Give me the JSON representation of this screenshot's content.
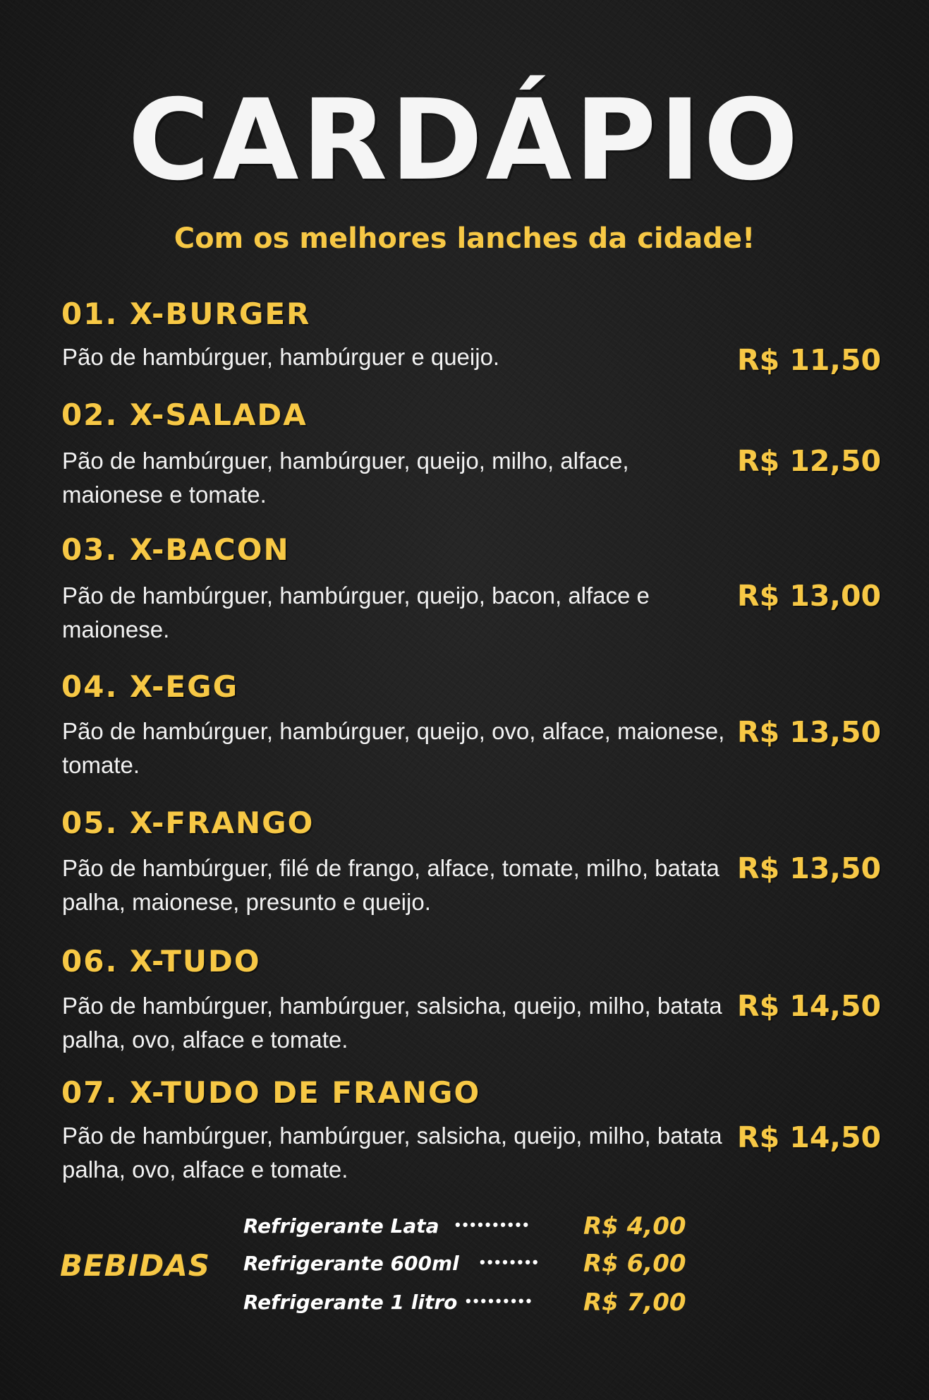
{
  "header": {
    "title": "CARDÁPIO",
    "subtitle": "Com os melhores lanches da cidade!"
  },
  "items": [
    {
      "name": "01. X-BURGER",
      "desc": "Pão de hambúrguer, hambúrguer e queijo.",
      "price": "R$ 11,50"
    },
    {
      "name": "02. X-SALADA",
      "desc": "Pão de hambúrguer, hambúrguer, queijo, milho, alface, maionese e tomate.",
      "price": "R$ 12,50"
    },
    {
      "name": "03. X-BACON",
      "desc": "Pão de hambúrguer, hambúrguer, queijo, bacon, alface e maionese.",
      "price": "R$ 13,00"
    },
    {
      "name": "04. X-EGG",
      "desc": "Pão de hambúrguer, hambúrguer, queijo, ovo, alface, maionese, tomate.",
      "price": "R$ 13,50"
    },
    {
      "name": "05. X-FRANGO",
      "desc": "Pão de hambúrguer, filé de frango, alface, tomate, milho, batata palha, maionese, presunto e queijo.",
      "price": "R$ 13,50"
    },
    {
      "name": "06. X-TUDO",
      "desc": "Pão de hambúrguer, hambúrguer, salsicha, queijo, milho, batata palha, ovo, alface e tomate.",
      "price": "R$ 14,50"
    },
    {
      "name": "07. X-TUDO DE FRANGO",
      "desc": "Pão de hambúrguer, hambúrguer, salsicha, queijo, milho, batata palha, ovo, alface e tomate.",
      "price": "R$ 14,50"
    }
  ],
  "drinks": {
    "title": "BEBIDAS",
    "items": [
      {
        "name": "Refrigerante Lata",
        "price": "R$ 4,00"
      },
      {
        "name": "Refrigerante 600ml",
        "price": "R$ 6,00"
      },
      {
        "name": "Refrigerante 1 litro",
        "price": "R$ 7,00"
      }
    ]
  },
  "colors": {
    "background": "#1b1b1b",
    "accent": "#f7c845",
    "text": "#f2f2f2"
  }
}
